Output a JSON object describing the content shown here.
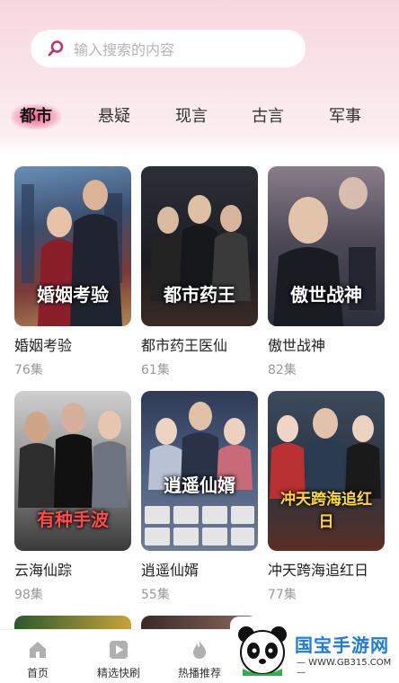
{
  "search": {
    "placeholder": "输入搜索的内容"
  },
  "tabs": [
    {
      "label": "都市",
      "active": true
    },
    {
      "label": "悬疑"
    },
    {
      "label": "现言"
    },
    {
      "label": "古言"
    },
    {
      "label": "军事"
    }
  ],
  "dramas": [
    {
      "name": "婚姻考验",
      "episodes": "76集",
      "poster_text": "婚姻考验"
    },
    {
      "name": "都市药王医仙",
      "episodes": "61集",
      "poster_text": "都市药王"
    },
    {
      "name": "傲世战神",
      "episodes": "82集",
      "poster_text": "傲世战神"
    },
    {
      "name": "云海仙踪",
      "episodes": "98集",
      "poster_text": "有种手波"
    },
    {
      "name": "逍遥仙婿",
      "episodes": "55集",
      "poster_text": "逍遥仙婿"
    },
    {
      "name": "冲天跨海追红日",
      "episodes": "77集",
      "poster_text": "冲天跨海追红日"
    }
  ],
  "bottom_nav": [
    {
      "label": "首页",
      "icon": "home-icon"
    },
    {
      "label": "精选快刷",
      "icon": "play-icon"
    },
    {
      "label": "热播推荐",
      "icon": "flame-icon"
    }
  ],
  "watermark": {
    "brand": "国宝手游网",
    "url": "— WWW.GB315.COM —"
  },
  "colors": {
    "accent": "#e9578a",
    "search_icon": "#c2316f",
    "watermark_blue": "#1e7be0"
  }
}
